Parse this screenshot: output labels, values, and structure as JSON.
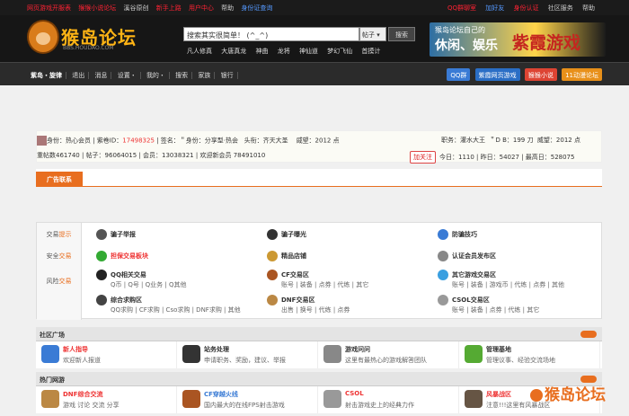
{
  "topbar": {
    "left": [
      "网页游戏开服表",
      "猴猴小说论坛",
      "溪谷原创",
      "新手上路",
      "用户中心",
      "帮助",
      "身份证查询"
    ],
    "right": [
      "QQ群聊室",
      "加好友",
      "身份认证",
      "社区服务",
      "帮助"
    ]
  },
  "logo": {
    "title": "猴岛论坛",
    "url": "BBS.HOUDAO.COM"
  },
  "search": {
    "value": "搜索其实很简单！ (^_^)",
    "type": "帖子",
    "button": "搜索",
    "hot": [
      "凡人修真",
      "大唐真龙",
      "神曲",
      "龙将",
      "神仙道",
      "梦幻飞仙",
      "首摸计"
    ]
  },
  "banner": {
    "l1": "猴岛论坛自己的",
    "l2": "休闲、娱乐",
    "l3": "紫霞游戏"
  },
  "nav": {
    "items": [
      "紫岛・旋律",
      "退出",
      "消息",
      "设置・",
      "我的・",
      "搜索",
      "家族",
      "银行"
    ],
    "buttons": [
      "QQ群",
      "紫霞网页游戏",
      "猴猴小说",
      "11动漫论坛"
    ]
  },
  "user": {
    "avatar": "身份：热心会员",
    "r1": "紫卷ID：",
    "id": "17498325",
    "sign": "签名：＂身份：分享型·热会",
    "title": "头衔：齐天大圣",
    "wt": "威望：2012 点",
    "job": "职务：灌水大王",
    "db": "＂D B：199 刀",
    "wt2": "威望：2012 点",
    "r2a": "重帖数",
    "r2b": "461740",
    "posts": "帖子：96064015",
    "members": "会员：13038321",
    "welcome": "欢迎新会员",
    "newmember": "78491010",
    "follow": "加关注",
    "today": "今日：1110",
    "yesterday": "昨日：54027",
    "max": "最高日：528075"
  },
  "ad": {
    "tab": "广告联系"
  },
  "trade": {
    "labels": [
      [
        "交易",
        "提示"
      ],
      [
        "安全",
        "交易"
      ],
      [
        "风险",
        "交易"
      ]
    ],
    "items": [
      {
        "n": "骗子举报",
        "s": ""
      },
      {
        "n": "骗子曝光",
        "s": ""
      },
      {
        "n": "防骗技巧",
        "s": ""
      },
      {
        "n": "担保交易板块",
        "s": ""
      },
      {
        "n": "精品店铺",
        "s": ""
      },
      {
        "n": "认证会员发布区",
        "s": ""
      },
      {
        "n": "QQ相关交易",
        "s": "Q币 | Q号 | Q业务 | Q其他"
      },
      {
        "n": "CF交易区",
        "s": "账号 | 装备 | 点券 | 代练 | 其它"
      },
      {
        "n": "其它游戏交易区",
        "s": "账号 | 装备 | 游戏币 | 代练 | 点券 | 其他"
      },
      {
        "n": "综合求购区",
        "s": "QQ求购 | CF求购 | Cso求购 | DNF求购 | 其他"
      },
      {
        "n": "DNF交易区",
        "s": "出售 | 换号 | 代练 | 点券"
      },
      {
        "n": "CSOL交易区",
        "s": "账号 | 装备 | 点券 | 代练 | 其它"
      }
    ]
  },
  "community": {
    "title": "社区广场",
    "cells": [
      {
        "n": "新人指导",
        "s": "欢迎新人报道"
      },
      {
        "n": "站务处理",
        "s": "申请职务、奖励，建议、举报"
      },
      {
        "n": "游戏问问",
        "s": "这里有最热心的游戏解答团队"
      },
      {
        "n": "管理基地",
        "s": "管理议事、经验交流场地"
      }
    ]
  },
  "hot": {
    "title": "热门网游",
    "cells": [
      {
        "n": "DNF综合交流",
        "s": "游戏 讨论 交流 分享"
      },
      {
        "n": "CF穿越火线",
        "s": "国内最大的在线FPS射击游戏"
      },
      {
        "n": "CSOL",
        "s": "射击游戏史上的经典力作"
      },
      {
        "n": "风暴战区",
        "s": "注意!!!这里有风暴战区"
      }
    ]
  },
  "watermark": "猴岛论坛"
}
